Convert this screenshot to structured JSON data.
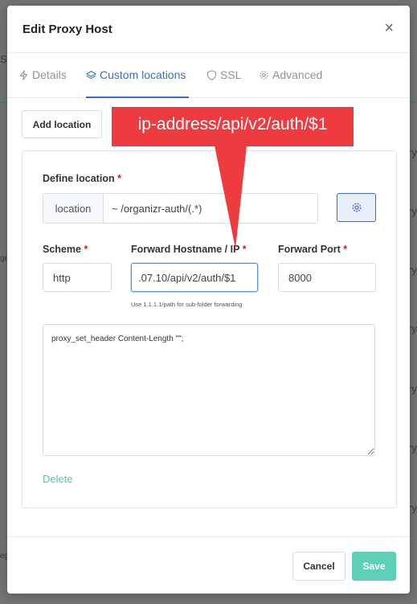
{
  "background": {
    "fragments": [
      "SL",
      "ge",
      "ry",
      "ry",
      "ry",
      "ry",
      "ry",
      "ry",
      "ry",
      "eg"
    ]
  },
  "modal": {
    "title": "Edit Proxy Host",
    "close_glyph": "×"
  },
  "tabs": [
    {
      "label": "Details",
      "icon": "bolt-icon",
      "active": false
    },
    {
      "label": "Custom locations",
      "icon": "layers-icon",
      "active": true
    },
    {
      "label": "SSL",
      "icon": "shield-icon",
      "active": false
    },
    {
      "label": "Advanced",
      "icon": "gear-icon",
      "active": false
    }
  ],
  "add_location_label": "Add location",
  "location": {
    "section_label": "Define location",
    "required_mark": "*",
    "addon_label": "location",
    "value": "~ /organizr-auth/(.*)"
  },
  "scheme": {
    "label": "Scheme",
    "value": "http"
  },
  "forward_host": {
    "label": "Forward Hostname / IP",
    "value": ".07.10/api/v2/auth/$1",
    "hint": "Use 1.1.1.1/path for sub-folder forwarding"
  },
  "forward_port": {
    "label": "Forward Port",
    "value": "8000"
  },
  "advanced_config": "proxy_set_header Content-Length \"\";",
  "delete_label": "Delete",
  "footer": {
    "cancel_label": "Cancel",
    "save_label": "Save"
  },
  "annotation": {
    "text": "ip-address/api/v2/auth/$1",
    "color": "#ee3b3f"
  },
  "colors": {
    "accent": "#3b6dc6",
    "save": "#5fd0b8",
    "delete": "#5cc1b1",
    "required": "#cd201f"
  }
}
